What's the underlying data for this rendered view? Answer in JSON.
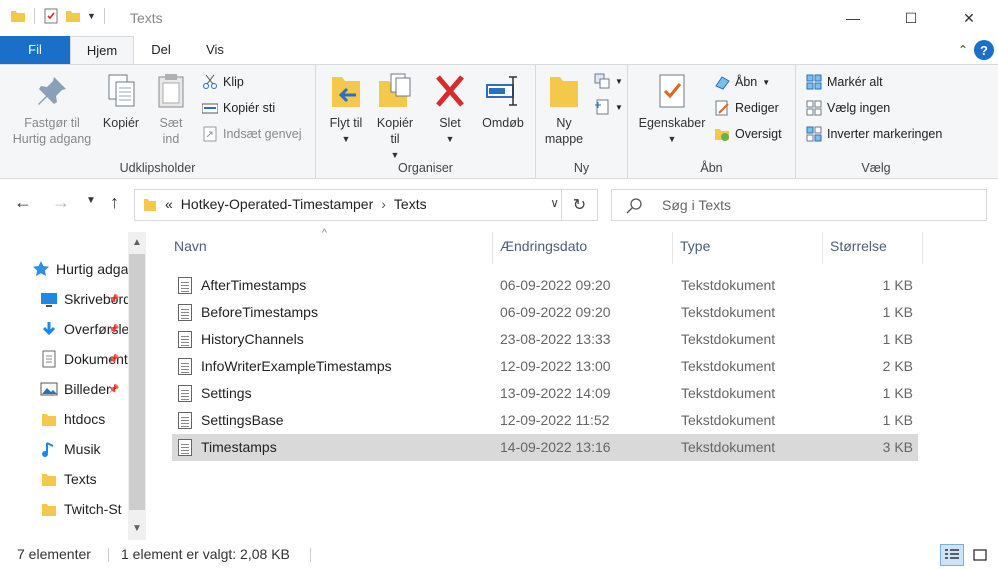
{
  "window": {
    "title": "Texts",
    "controls": {
      "minimize": "—",
      "maximize": "☐",
      "close": "✕"
    }
  },
  "ribbon_tabs": [
    {
      "label": "Fil"
    },
    {
      "label": "Hjem"
    },
    {
      "label": "Del"
    },
    {
      "label": "Vis"
    }
  ],
  "ribbon": {
    "clipboard": {
      "label": "Udklipsholder",
      "pin": "Fastgør til Hurtig adgang",
      "copy": "Kopiér",
      "paste": "Sæt ind",
      "cut": "Klip",
      "copy_path": "Kopiér sti",
      "paste_shortcut": "Indsæt genvej"
    },
    "organize": {
      "label": "Organiser",
      "move_to": "Flyt til",
      "copy_to": "Kopiér til",
      "delete": "Slet",
      "rename": "Omdøb"
    },
    "new": {
      "label": "Ny",
      "new_folder": "Ny mappe"
    },
    "open": {
      "label": "Åbn",
      "properties": "Egenskaber",
      "open": "Åbn",
      "edit": "Rediger",
      "history": "Oversigt"
    },
    "select": {
      "label": "Vælg",
      "select_all": "Markér alt",
      "select_none": "Vælg ingen",
      "invert": "Inverter markeringen"
    }
  },
  "address": {
    "prefix": "«",
    "crumbs": [
      "Hotkey-Operated-Timestamper",
      "Texts"
    ],
    "separator": "›"
  },
  "search": {
    "placeholder": "Søg i Texts"
  },
  "nav_pane": [
    {
      "label": "Hurtig adgang",
      "icon": "star-icon",
      "pinned": false
    },
    {
      "label": "Skrivebord",
      "icon": "desktop-icon",
      "pinned": true
    },
    {
      "label": "Overførsler",
      "icon": "download-icon",
      "pinned": true
    },
    {
      "label": "Dokumenter",
      "icon": "documents-icon",
      "pinned": true
    },
    {
      "label": "Billeder",
      "icon": "pictures-icon",
      "pinned": true
    },
    {
      "label": "htdocs",
      "icon": "folder-icon",
      "pinned": false
    },
    {
      "label": "Musik",
      "icon": "music-icon",
      "pinned": false
    },
    {
      "label": "Texts",
      "icon": "folder-icon",
      "pinned": false
    },
    {
      "label": "Twitch-St",
      "icon": "folder-icon",
      "pinned": false
    }
  ],
  "columns": {
    "name": "Navn",
    "date": "Ændringsdato",
    "type": "Type",
    "size": "Størrelse"
  },
  "files": [
    {
      "name": "AfterTimestamps",
      "date": "06-09-2022 09:20",
      "type": "Tekstdokument",
      "size": "1 KB",
      "selected": false
    },
    {
      "name": "BeforeTimestamps",
      "date": "06-09-2022 09:20",
      "type": "Tekstdokument",
      "size": "1 KB",
      "selected": false
    },
    {
      "name": "HistoryChannels",
      "date": "23-08-2022 13:33",
      "type": "Tekstdokument",
      "size": "1 KB",
      "selected": false
    },
    {
      "name": "InfoWriterExampleTimestamps",
      "date": "12-09-2022 13:00",
      "type": "Tekstdokument",
      "size": "2 KB",
      "selected": false
    },
    {
      "name": "Settings",
      "date": "13-09-2022 14:09",
      "type": "Tekstdokument",
      "size": "1 KB",
      "selected": false
    },
    {
      "name": "SettingsBase",
      "date": "12-09-2022 11:52",
      "type": "Tekstdokument",
      "size": "1 KB",
      "selected": false
    },
    {
      "name": "Timestamps",
      "date": "14-09-2022 13:16",
      "type": "Tekstdokument",
      "size": "3 KB",
      "selected": true
    }
  ],
  "status": {
    "count": "7 elementer",
    "selection": "1 element er valgt: 2,08 KB"
  },
  "colors": {
    "accent": "#1a6fc9",
    "folder": "#f4c84b",
    "delete_red": "#d92b2b",
    "selected_row": "#d9d9d9"
  }
}
